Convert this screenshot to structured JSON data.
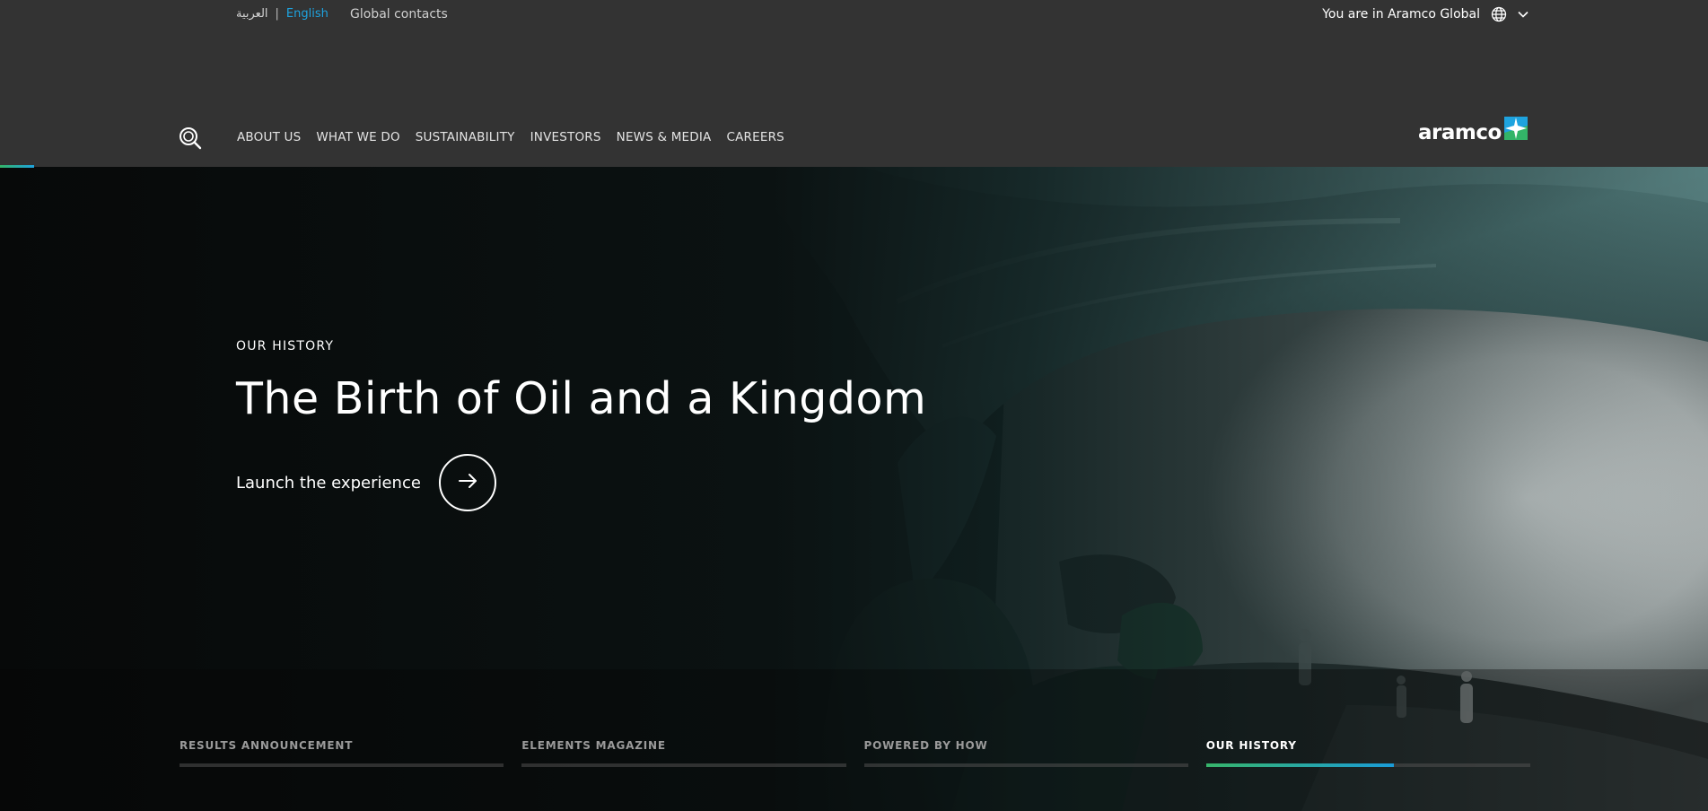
{
  "utility": {
    "arabic": "العربية",
    "separator": "|",
    "english": "English",
    "global_contacts": "Global contacts",
    "region": "You are in Aramco Global"
  },
  "nav": {
    "items": [
      {
        "label": "ABOUT US"
      },
      {
        "label": "WHAT WE DO"
      },
      {
        "label": "SUSTAINABILITY"
      },
      {
        "label": "INVESTORS"
      },
      {
        "label": "NEWS & MEDIA"
      },
      {
        "label": "CAREERS"
      }
    ],
    "logo_text": "aramco"
  },
  "hero": {
    "eyebrow": "OUR HISTORY",
    "title": "The Birth of Oil and a Kingdom",
    "cta_label": "Launch the experience"
  },
  "tabs": [
    {
      "label": "RESULTS ANNOUNCEMENT",
      "progress": 0,
      "active": false
    },
    {
      "label": "ELEMENTS MAGAZINE",
      "progress": 0,
      "active": false
    },
    {
      "label": "POWERED BY HOW",
      "progress": 0,
      "active": false
    },
    {
      "label": "OUR HISTORY",
      "progress": 0.58,
      "active": true
    }
  ],
  "colors": {
    "header_bg": "#333333",
    "accent_blue": "#1ea3df",
    "accent_green": "#33b468"
  },
  "icons": {
    "search": "search-icon",
    "globe": "globe-icon",
    "chevron": "chevron-down-icon",
    "arrow": "arrow-right-icon"
  }
}
